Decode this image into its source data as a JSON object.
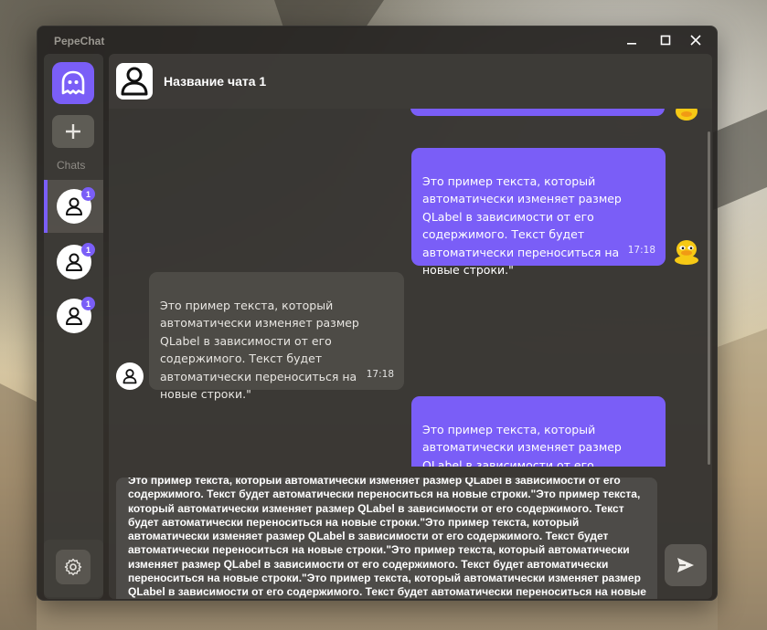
{
  "window": {
    "app_title": "PepeChat"
  },
  "sidebar": {
    "chats_label": "Chats",
    "chats": [
      {
        "badge": "1",
        "active": true
      },
      {
        "badge": "1",
        "active": false
      },
      {
        "badge": "1",
        "active": false
      }
    ]
  },
  "chat": {
    "title": "Название чата 1",
    "messages": [
      {
        "direction": "out",
        "text": "Это пример текста, который\nавтоматически изменяет размер\nQLabel в зависимости от его\nсодержимого. Текст будет\nавтоматически переноситься на\nновые строки.\"",
        "time": "17:18"
      },
      {
        "direction": "in",
        "text": "Это пример текста, который\nавтоматически изменяет размер\nQLabel в зависимости от его\nсодержимого. Текст будет\nавтоматически переноситься на\nновые строки.\"",
        "time": "17:18"
      },
      {
        "direction": "out",
        "text": "Это пример текста, который\nавтоматически изменяет размер\nQLabel в зависимости от его\nсодержимого. Текст будет",
        "time": ""
      }
    ]
  },
  "composer": {
    "value": "Это пример текста, который автоматически изменяет размер QLabel в зависимости от его содержимого. Текст будет автоматически переноситься на новые строки.\"Это пример текста, который автоматически изменяет размер QLabel в зависимости от его содержимого. Текст будет автоматически переноситься на новые строки.\"Это пример текста, который автоматически изменяет размер QLabel в зависимости от его содержимого. Текст будет автоматически переноситься на новые строки.\"Это пример текста, который автоматически изменяет размер QLabel в зависимости от его содержимого. Текст будет автоматически переноситься на новые строки.\"Это пример текста, который автоматически изменяет размер QLabel в зависимости от его содержимого. Текст будет автоматически переноситься на новые строки.\""
  },
  "colors": {
    "accent": "#7a5ef7",
    "window_bg": "#262421",
    "incoming_bubble": "#4e4c48"
  },
  "icons": {
    "logo": "chat-bubble-icon",
    "add": "plus-icon",
    "settings": "gear-icon",
    "send": "send-icon",
    "user": "user-icon",
    "duck": "duck-avatar-icon",
    "minimize": "minimize-icon",
    "maximize": "maximize-icon",
    "close": "close-icon"
  }
}
